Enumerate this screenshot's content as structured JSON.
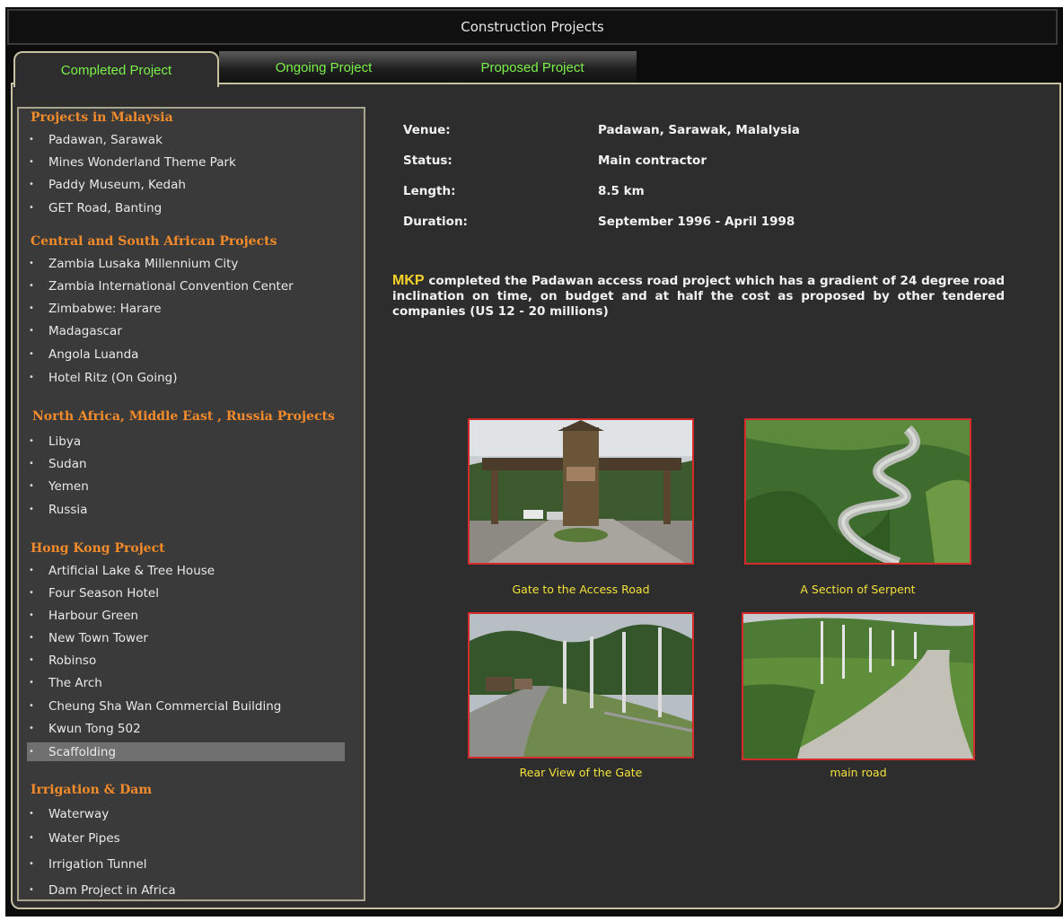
{
  "window": {
    "title": "Construction Projects"
  },
  "tabs": [
    {
      "label": "Completed Project"
    },
    {
      "label": "Ongoing Project"
    },
    {
      "label": "Proposed Project"
    }
  ],
  "sidebar": {
    "sections": [
      {
        "heading": "Projects in Malaysia",
        "items": [
          "Padawan, Sarawak",
          "Mines Wonderland Theme Park",
          "Paddy Museum, Kedah",
          "GET Road, Banting"
        ]
      },
      {
        "heading": "Central and South African Projects",
        "items": [
          "Zambia Lusaka Millennium City",
          "Zambia International Convention Center",
          "Zimbabwe: Harare",
          "Madagascar",
          "Angola Luanda",
          "Hotel Ritz (On Going)"
        ]
      },
      {
        "heading": "North Africa, Middle East , Russia Projects",
        "items": [
          "Libya",
          "Sudan",
          "Yemen",
          "Russia"
        ]
      },
      {
        "heading": "Hong Kong Project",
        "items": [
          "Artificial Lake & Tree House",
          "Four Season Hotel",
          "Harbour Green",
          "New Town Tower",
          "Robinso",
          "The Arch",
          "Cheung Sha Wan Commercial Building",
          "Kwun Tong 502",
          "Scaffolding"
        ]
      },
      {
        "heading": "Irrigation & Dam",
        "items": [
          "Waterway",
          "Water Pipes",
          "Irrigation Tunnel",
          "Dam Project in Africa"
        ]
      }
    ],
    "selected_item": "Scaffolding"
  },
  "details": {
    "venue_label": "Venue:",
    "venue_value": "Padawan, Sarawak, Malalysia",
    "status_label": "Status:",
    "status_value": "Main contractor",
    "length_label": "Length:",
    "length_value": "8.5 km",
    "duration_label": "Duration:",
    "duration_value": "September 1996 - April 1998"
  },
  "description": {
    "brand": "MKP",
    "text": "completed the Padawan access road project which has a gradient of 24 degree road inclination on time, on budget and at half the cost as proposed by other tendered companies (US 12 - 20 millions)"
  },
  "photos": [
    {
      "caption": "Gate to the Access Road",
      "icon": "gate-photo"
    },
    {
      "caption": "A Section of Serpent",
      "icon": "serpent-road-photo"
    },
    {
      "caption": "Rear View of the Gate",
      "icon": "rear-gate-photo"
    },
    {
      "caption": "main road",
      "icon": "main-road-photo"
    }
  ],
  "colors": {
    "tab_text": "#7cf04a",
    "section_heading": "#f48b2a",
    "caption": "#f3e23a",
    "brand": "#f6d22c",
    "photo_border": "#d62b2b"
  }
}
